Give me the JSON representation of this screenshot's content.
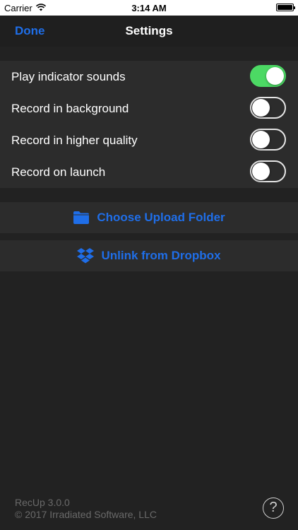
{
  "status_bar": {
    "carrier": "Carrier",
    "time": "3:14 AM",
    "wifi_icon": "wifi-icon",
    "battery_icon": "battery-icon"
  },
  "nav": {
    "done_label": "Done",
    "title": "Settings"
  },
  "settings": [
    {
      "label": "Play indicator sounds",
      "enabled": true
    },
    {
      "label": "Record in background",
      "enabled": false
    },
    {
      "label": "Record in higher quality",
      "enabled": false
    },
    {
      "label": "Record on launch",
      "enabled": false
    }
  ],
  "actions": {
    "upload": {
      "label": "Choose Upload Folder",
      "icon": "folder-icon"
    },
    "unlink": {
      "label": "Unlink from Dropbox",
      "icon": "dropbox-icon"
    }
  },
  "footer": {
    "version": "RecUp 3.0.0",
    "copyright": "© 2017 Irradiated Software, LLC",
    "help_label": "?"
  },
  "colors": {
    "accent": "#1f6ee8",
    "toggle_on": "#4cd964",
    "background": "#222222",
    "row_background": "#2c2c2c"
  }
}
